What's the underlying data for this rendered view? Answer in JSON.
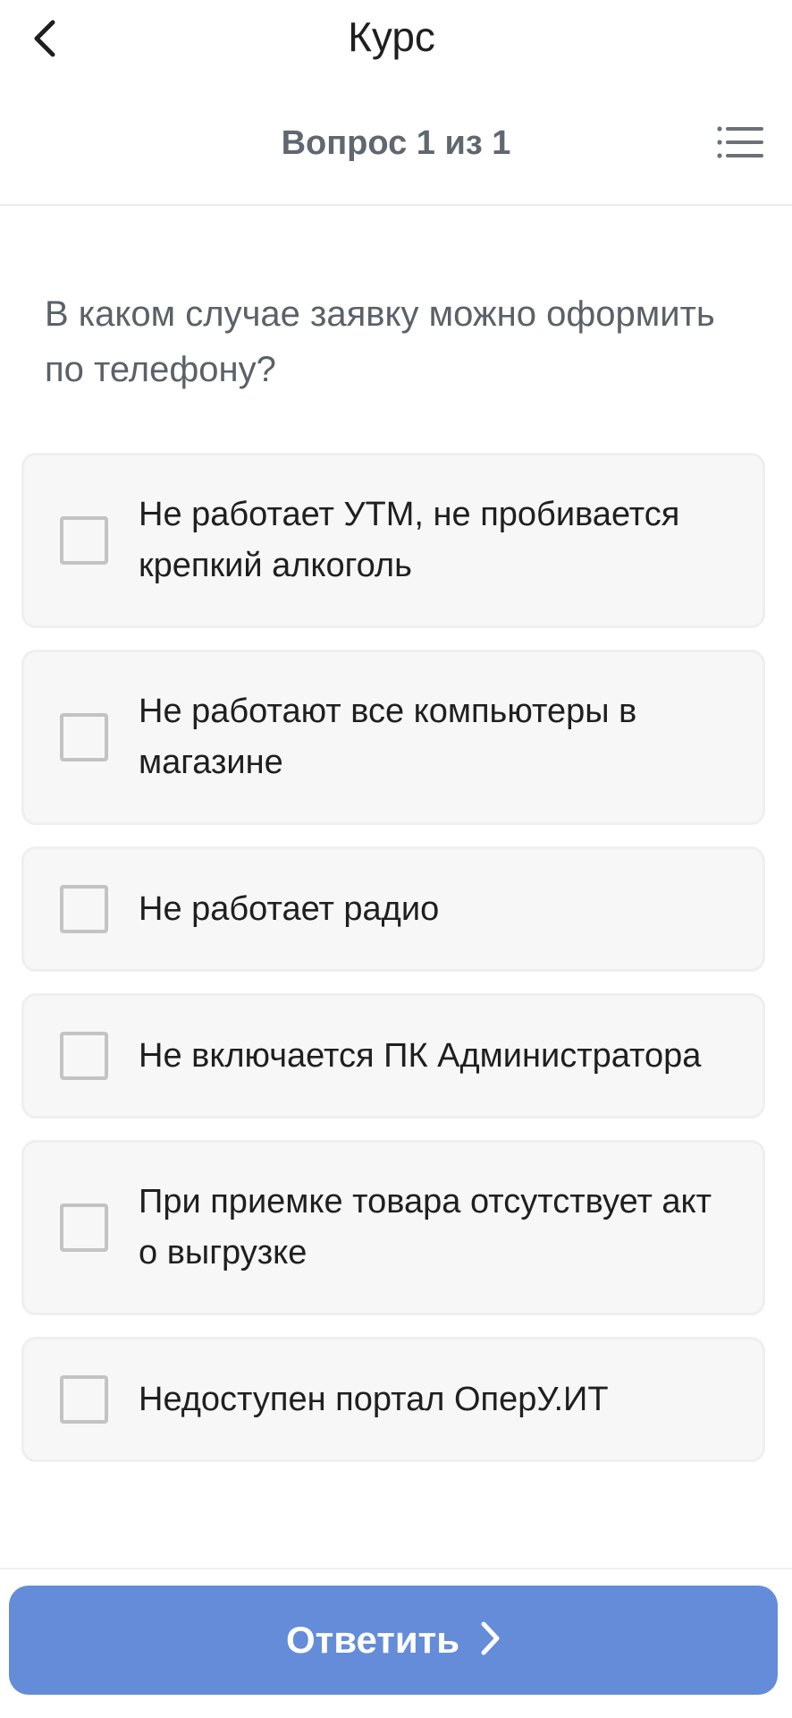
{
  "header": {
    "title": "Курс",
    "back_icon": "chevron-left-icon"
  },
  "subheader": {
    "counter": "Вопрос 1 из 1",
    "list_icon": "list-icon"
  },
  "question": {
    "text": "В каком случае заявку можно оформить по телефону?"
  },
  "options": [
    {
      "label": "Не работает УТМ, не пробивается крепкий алкоголь",
      "checked": false
    },
    {
      "label": "Не работают все компьютеры в магазине",
      "checked": false
    },
    {
      "label": "Не работает радио",
      "checked": false
    },
    {
      "label": "Не включается ПК Администратора",
      "checked": false
    },
    {
      "label": "При приемке товара отсутствует акт о выгрузке",
      "checked": false
    },
    {
      "label": "Недоступен портал ОперУ.ИТ",
      "checked": false
    }
  ],
  "footer": {
    "submit_label": "Ответить",
    "submit_icon": "chevron-right-icon",
    "submit_color": "#648cd8"
  }
}
